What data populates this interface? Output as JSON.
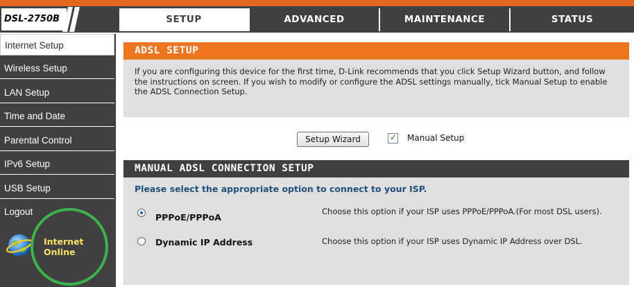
{
  "device": {
    "model": "DSL-2750B"
  },
  "tabs": [
    {
      "label": "SETUP",
      "active": true
    },
    {
      "label": "ADVANCED",
      "active": false
    },
    {
      "label": "MAINTENANCE",
      "active": false
    },
    {
      "label": "STATUS",
      "active": false
    }
  ],
  "sidebar": {
    "items": [
      {
        "label": "Internet Setup",
        "active": true
      },
      {
        "label": "Wireless Setup",
        "active": false
      },
      {
        "label": "LAN Setup",
        "active": false
      },
      {
        "label": "Time and Date",
        "active": false
      },
      {
        "label": "Parental Control",
        "active": false
      },
      {
        "label": "IPv6 Setup",
        "active": false
      },
      {
        "label": "USB Setup",
        "active": false
      },
      {
        "label": "Logout",
        "active": false
      }
    ],
    "status": {
      "line1": "Internet",
      "line2": "Online",
      "icon": "globe-icon"
    }
  },
  "adsl": {
    "title": "ADSL SETUP",
    "description": "If you are configuring this device for the first time, D-Link recommends that you click Setup Wizard button, and follow the instructions on screen. If you wish to modify or configure the ADSL settings manually, tick Manual Setup to enable the ADSL Connection Setup."
  },
  "wizard": {
    "button_label": "Setup Wizard",
    "manual_setup_label": "Manual Setup",
    "manual_setup_checked": true
  },
  "manual": {
    "title": "MANUAL ADSL CONNECTION SETUP",
    "prompt": "Please select the appropriate option to connect to your ISP.",
    "options": [
      {
        "label": "PPPoE/PPPoA",
        "description": "Choose this option if your ISP uses PPPoE/PPPoA.(For most DSL users).",
        "selected": true
      },
      {
        "label": "Dynamic IP Address",
        "description": "Choose this option if your ISP uses Dynamic IP Address over DSL.",
        "selected": false
      }
    ]
  },
  "colors": {
    "brand_orange": "#f0751e",
    "dark_gray": "#404040",
    "prompt_blue": "#1f4f7b",
    "highlight_ring": "#3db24a"
  }
}
